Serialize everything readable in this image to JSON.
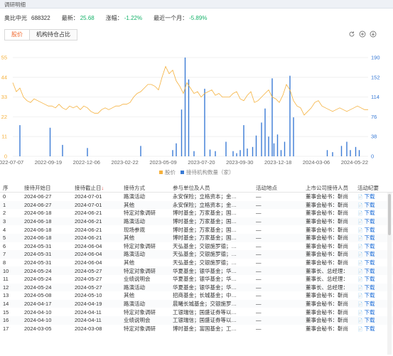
{
  "header": {
    "title": "调研明细"
  },
  "stock": {
    "name": "奥比中光",
    "code": "688322",
    "latest_label": "最新：",
    "latest_value": "25.68",
    "change_label": "涨幅：",
    "change_value": "-1.22%",
    "month_label": "最近一个月：",
    "month_value": "-5.89%"
  },
  "tabs": [
    {
      "label": "股价",
      "active": true
    },
    {
      "label": "机构持仓占比",
      "active": false
    }
  ],
  "tools": [
    "refresh-icon",
    "zoom-in-icon",
    "download-icon"
  ],
  "colors": {
    "price_line": "#f5b13d",
    "bars": "#3a7bd5",
    "up": "#e0443e",
    "down": "#16b26a",
    "accent": "#f0662b"
  },
  "chart_data": {
    "type": "bar",
    "left_axis_ticks": [
      "55",
      "44",
      "33",
      "22",
      "11",
      "0"
    ],
    "right_axis_ticks": [
      "190",
      "152",
      "114",
      "76",
      "38",
      "0"
    ],
    "left_ylim": [
      0,
      55
    ],
    "right_ylim": [
      0,
      190
    ],
    "x_ticks": [
      "2022-07-07",
      "2022-09-19",
      "2022-12-06",
      "2023-02-22",
      "2023-05-09",
      "2023-07-20",
      "2023-09-30",
      "2023-12-18",
      "2024-03-06",
      "2024-05-22"
    ],
    "x_range": [
      0,
      1
    ],
    "series": [
      {
        "name": "股价",
        "type": "line",
        "axis": "left",
        "x": [
          0.0,
          0.01,
          0.02,
          0.03,
          0.04,
          0.05,
          0.06,
          0.07,
          0.08,
          0.09,
          0.1,
          0.11,
          0.12,
          0.13,
          0.14,
          0.15,
          0.16,
          0.17,
          0.18,
          0.19,
          0.2,
          0.21,
          0.22,
          0.23,
          0.24,
          0.25,
          0.26,
          0.27,
          0.28,
          0.29,
          0.3,
          0.31,
          0.32,
          0.33,
          0.34,
          0.35,
          0.36,
          0.37,
          0.38,
          0.39,
          0.4,
          0.41,
          0.42,
          0.43,
          0.44,
          0.45,
          0.46,
          0.47,
          0.48,
          0.49,
          0.5,
          0.51,
          0.52,
          0.53,
          0.54,
          0.55,
          0.56,
          0.57,
          0.58,
          0.59,
          0.6,
          0.61,
          0.62,
          0.63,
          0.64,
          0.65,
          0.66,
          0.67,
          0.68,
          0.69,
          0.7,
          0.71,
          0.72,
          0.73,
          0.74,
          0.75,
          0.76,
          0.77,
          0.78,
          0.79,
          0.8,
          0.81,
          0.82,
          0.83,
          0.84,
          0.85,
          0.86,
          0.87,
          0.88,
          0.89,
          0.9,
          0.91,
          0.92,
          0.93,
          0.94,
          0.95,
          0.96,
          0.97,
          0.98,
          0.99,
          1.0
        ],
        "values": [
          41,
          36,
          38,
          33,
          31,
          30,
          32,
          31,
          30,
          29,
          28,
          28,
          27,
          29,
          27,
          26,
          28,
          27,
          28,
          26,
          28,
          27,
          25,
          24,
          24,
          26,
          27,
          26,
          27,
          28,
          28,
          29,
          29,
          30,
          33,
          35,
          36,
          38,
          40,
          40,
          39,
          37,
          44,
          50,
          46,
          48,
          42,
          39,
          35,
          41,
          38,
          35,
          36,
          33,
          35,
          36,
          37,
          34,
          35,
          33,
          33,
          33,
          35,
          36,
          32,
          31,
          34,
          36,
          30,
          31,
          33,
          35,
          37,
          33,
          32,
          30,
          34,
          40,
          37,
          31,
          28,
          27,
          23,
          25,
          27,
          30,
          31,
          28,
          27,
          26,
          25,
          26,
          27,
          26,
          25,
          26,
          27,
          28,
          27,
          26,
          26
        ]
      },
      {
        "name": "接待机构数量（家）",
        "type": "bar",
        "axis": "right",
        "x": [
          0.02,
          0.105,
          0.14,
          0.21,
          0.36,
          0.45,
          0.46,
          0.475,
          0.485,
          0.495,
          0.51,
          0.54,
          0.555,
          0.57,
          0.6,
          0.62,
          0.63,
          0.64,
          0.65,
          0.66,
          0.675,
          0.685,
          0.7,
          0.71,
          0.72,
          0.73,
          0.735,
          0.745,
          0.755,
          0.765,
          0.78,
          0.79,
          0.885,
          0.9,
          0.925,
          0.94,
          0.95,
          0.965,
          0.975
        ],
        "values": [
          60,
          55,
          22,
          16,
          20,
          12,
          25,
          90,
          190,
          148,
          10,
          130,
          13,
          10,
          28,
          10,
          6,
          12,
          60,
          15,
          18,
          40,
          65,
          92,
          38,
          150,
          25,
          42,
          12,
          28,
          155,
          75,
          12,
          8,
          20,
          28,
          12,
          18,
          12
        ]
      }
    ],
    "legend": [
      "股价",
      "接待机构数量（家）"
    ],
    "legend_placement": "bottom-center"
  },
  "table": {
    "columns": [
      "序",
      "接待开始日",
      "接待截止日",
      "接待方式",
      "参与单位及人员",
      "活动地点",
      "上市公司接待人员",
      "活动纪要"
    ],
    "sort_column_suffix": "↓",
    "download_label": "下载",
    "rows": [
      [
        "0",
        "2024-06-27",
        "2024-07-01",
        "路演活动",
        "永安保险；立格资本；金…",
        "—",
        "董事会秘书：靳尚"
      ],
      [
        "1",
        "2024-06-27",
        "2024-07-01",
        "其他",
        "永安保险；立格资本；金…",
        "—",
        "董事会秘书：靳尚"
      ],
      [
        "2",
        "2024-06-18",
        "2024-06-21",
        "特定对象调研",
        "博时基金；万家基金；国…",
        "—",
        "董事会秘书：靳尚"
      ],
      [
        "3",
        "2024-06-18",
        "2024-06-21",
        "路演活动",
        "博时基金；万家基金；国…",
        "—",
        "董事会秘书：靳尚"
      ],
      [
        "4",
        "2024-06-18",
        "2024-06-21",
        "现场参观",
        "博时基金；万家基金；国…",
        "—",
        "董事会秘书：靳尚"
      ],
      [
        "5",
        "2024-06-18",
        "2024-06-21",
        "其他",
        "博时基金；万家基金；国…",
        "—",
        "董事会秘书：靳尚"
      ],
      [
        "6",
        "2024-05-31",
        "2024-06-04",
        "特定对象调研",
        "天弘基金；交银施罗德；…",
        "—",
        "董事会秘书：靳尚"
      ],
      [
        "7",
        "2024-05-31",
        "2024-06-04",
        "路演活动",
        "天弘基金；交银施罗德；…",
        "—",
        "董事会秘书：靳尚"
      ],
      [
        "8",
        "2024-05-31",
        "2024-06-04",
        "其他",
        "天弘基金；交银施罗德；…",
        "—",
        "董事会秘书：靳尚"
      ],
      [
        "10",
        "2024-05-24",
        "2024-05-27",
        "特定对象调研",
        "华夏基金；银华基金；华…",
        "—",
        "董事长、总经理："
      ],
      [
        "11",
        "2024-05-24",
        "2024-05-27",
        "业绩说明会",
        "华夏基金；银华基金；华…",
        "—",
        "董事长、总经理："
      ],
      [
        "12",
        "2024-05-24",
        "2024-05-27",
        "路演活动",
        "华夏基金；银华基金；华…",
        "—",
        "董事长、总经理："
      ],
      [
        "13",
        "2024-05-08",
        "2024-05-10",
        "其他",
        "招商基金；长城基金；中…",
        "—",
        "董事会秘书：靳尚"
      ],
      [
        "14",
        "2024-04-17",
        "2024-04-19",
        "路演活动",
        "晨曦长城基金；交银施罗…",
        "—",
        "董事会秘书：靳尚"
      ],
      [
        "15",
        "2024-04-10",
        "2024-04-11",
        "特定对象调研",
        "工银瑞信；国盛证券等以…",
        "—",
        "董事会秘书：靳尚"
      ],
      [
        "16",
        "2024-04-10",
        "2024-04-11",
        "业绩说明会",
        "工银瑞信；国盛证券等以…",
        "—",
        "董事会秘书：靳尚"
      ],
      [
        "17",
        "2024-03-05",
        "2024-03-08",
        "特定对象调研",
        "博时基金；富国基金；工…",
        "—",
        "董事会秘书：靳尚"
      ]
    ]
  }
}
